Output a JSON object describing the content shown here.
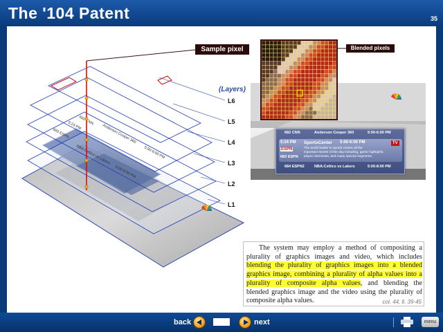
{
  "header": {
    "title": "The '104 Patent",
    "slide_number": "35"
  },
  "callouts": {
    "sample_pixel": "Sample pixel",
    "blended_pixels": "Blended  pixels"
  },
  "layers": {
    "title": "(Layers)",
    "labels": [
      "L6",
      "L5",
      "L4",
      "L3",
      "L2",
      "L1"
    ]
  },
  "tv_guide": {
    "rows": [
      {
        "channel": "682  CNN",
        "program": "Anderson Cooper 360",
        "time": "5:00-6:00 PM"
      },
      {
        "channel": "684  ESPN2",
        "program": "NBA:Celtics vs Lakers",
        "time": "5:00-8:00 PM"
      }
    ],
    "selected": {
      "clock": "5:24 PM",
      "logo": "ESPN",
      "channel": "683  ESPN",
      "program": "SportsCenter",
      "time": "5:00-6:00 PM",
      "description": [
        "The world leader in sports covers all the",
        "important stories of the day including, game highlights,",
        "player interviews, and many special segments."
      ],
      "badge": "TV"
    }
  },
  "quote": {
    "lines": [
      {
        "parts": [
          {
            "text": "The system may employ a method of compositing a",
            "hl": false
          }
        ],
        "indent": true
      },
      {
        "parts": [
          {
            "text": "plurality of graphics images and video, which includes",
            "hl": false
          }
        ]
      },
      {
        "parts": [
          {
            "text": "blending the plurality of graphics images into a blended",
            "hl": true
          }
        ]
      },
      {
        "parts": [
          {
            "text": "graphics image, combining a plurality of alpha values into a",
            "hl": true
          }
        ]
      },
      {
        "parts": [
          {
            "text": "plurality of composite alpha values",
            "hl": true
          },
          {
            "text": ", and blending the",
            "hl": false
          }
        ]
      },
      {
        "parts": [
          {
            "text": "blended graphics image and the video using the plurality of",
            "hl": false
          }
        ]
      },
      {
        "parts": [
          {
            "text": "composite alpha values.",
            "hl": false
          }
        ],
        "last": true
      }
    ],
    "citation": "col. 44, ll. 39-45"
  },
  "footer": {
    "back_label": "back",
    "next_label": "next",
    "menu_label": "menu"
  },
  "icons": [
    "back-arrow-icon",
    "next-arrow-icon",
    "printer-icon",
    "peacock-logo-icon"
  ],
  "colors": {
    "highlight": "#ffff2e",
    "accent_red": "#cc1111",
    "frame_blue": "#1f3fb5",
    "header_blue": "#0a3a7c"
  }
}
